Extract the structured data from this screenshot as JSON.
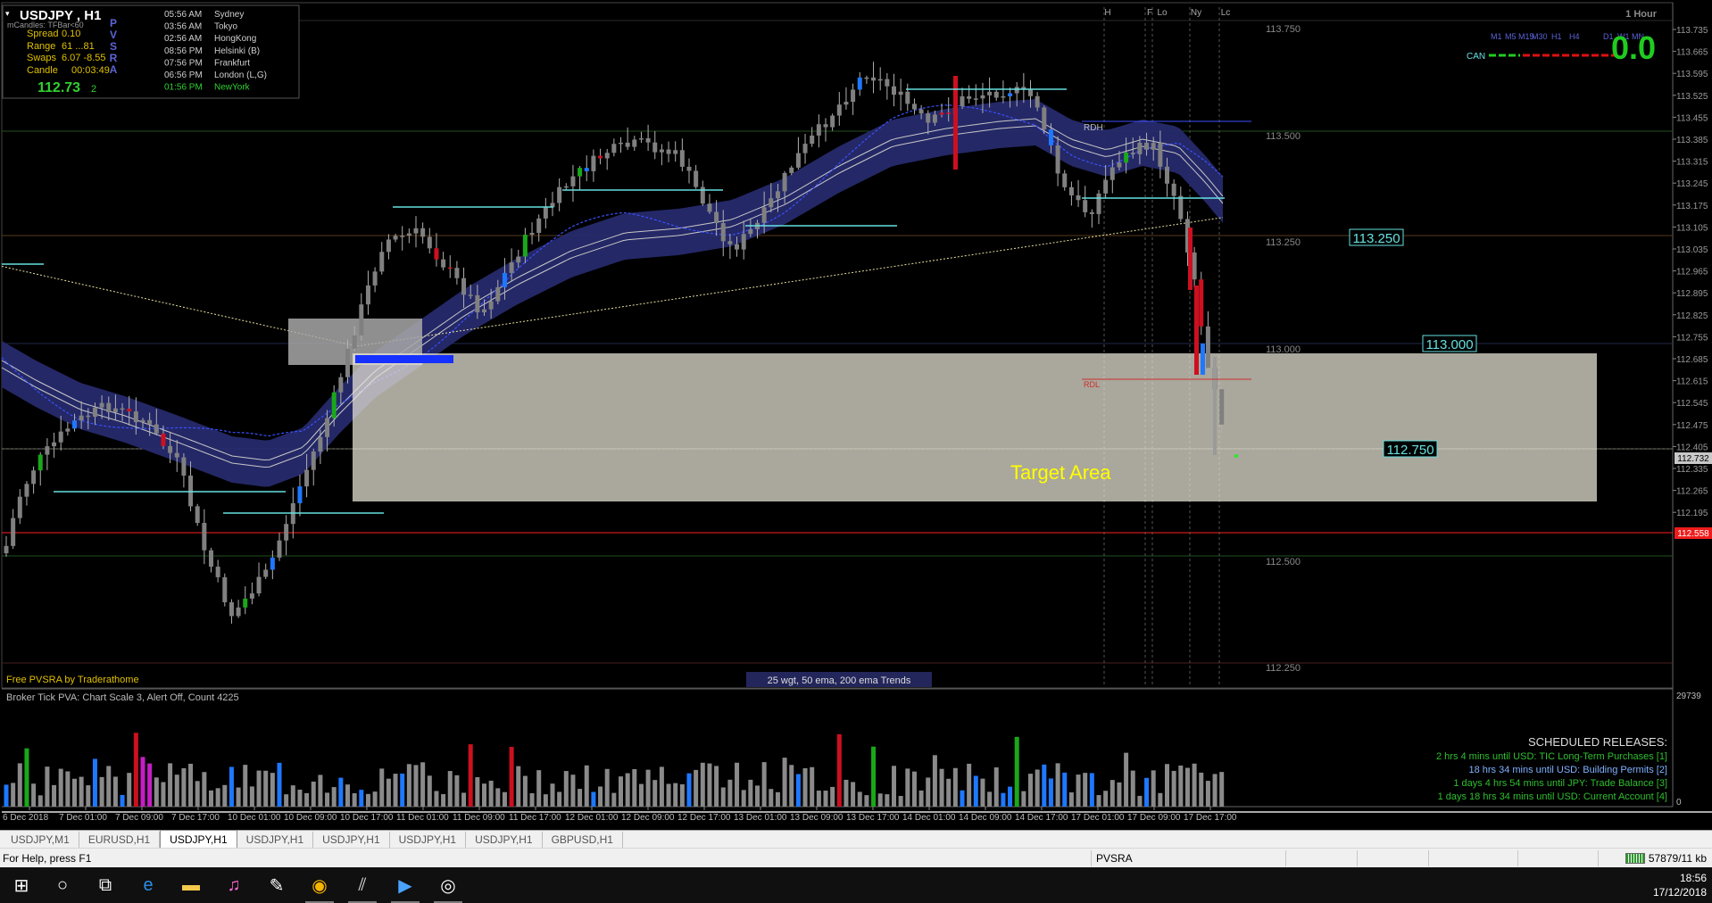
{
  "colors": {
    "background": "#000000",
    "bull_candle": "#1aa81a",
    "bear_candle": "#cc1020",
    "neutral_candle": "#808080",
    "climax_blue": "#1e78ff",
    "climax_magenta": "#c41ec4",
    "band": "#262a6b",
    "target_zone": "#ece7d8",
    "level_cyan": "#66e0e0",
    "label_yellow": "#ffff00"
  },
  "info_panel": {
    "symbol": "USDJPY , H1",
    "subtitle": "mCandles: TFBar<60",
    "spread_label": "Spread",
    "spread_value": "0.10",
    "range_label": "Range",
    "range_value": "61 ...81",
    "swaps_label": "Swaps",
    "swaps_value": "6.07 -8.55",
    "candle_label": "Candle",
    "candle_value": "00:03:49",
    "price_main": "112.73",
    "price_suffix": "2",
    "pvsra": [
      "P",
      "V",
      "S",
      "R",
      "A"
    ],
    "sessions": [
      {
        "time": "05:56 AM",
        "city": "Sydney"
      },
      {
        "time": "03:56 AM",
        "city": "Tokyo"
      },
      {
        "time": "02:56 AM",
        "city": "HongKong"
      },
      {
        "time": "08:56 PM",
        "city": "Helsinki (B)"
      },
      {
        "time": "07:56 PM",
        "city": "Frankfurt"
      },
      {
        "time": "06:56 PM",
        "city": "London (L,G)"
      },
      {
        "time": "01:56 PM",
        "city": "NewYork"
      }
    ]
  },
  "timeframes": [
    "M1",
    "M5",
    "M15",
    "M30",
    "H1",
    "H4",
    "D1",
    "W1",
    "MN"
  ],
  "can_label": "CAN",
  "big_value": "0.0",
  "top_corner_label": "1 Hour",
  "session_markers": [
    "H",
    "F",
    "Lo",
    "Ny",
    "Lc"
  ],
  "level_labels": {
    "rdh": "RDH",
    "rdl": "RDL"
  },
  "round_labels": [
    "113.750",
    "113.500",
    "113.250",
    "113.000",
    "112.500",
    "112.250"
  ],
  "boxed_levels": [
    "113.250",
    "113.000",
    "112.750"
  ],
  "target_label": "Target Area",
  "footer_credit": "Free PVSRA by Traderathome",
  "footer_trends": "25 wgt, 50 ema, 200 ema Trends",
  "price_axis": [
    "113.735",
    "113.665",
    "113.595",
    "113.525",
    "113.455",
    "113.385",
    "113.315",
    "113.245",
    "113.175",
    "113.105",
    "113.035",
    "112.965",
    "112.895",
    "112.825",
    "112.755",
    "112.685",
    "112.615",
    "112.545",
    "112.475",
    "112.405",
    "112.335",
    "112.265",
    "112.195"
  ],
  "current_price_tag": "112.732",
  "red_line_tag": "112.558",
  "volume_panel": {
    "header": "Broker Tick PVA:   Chart Scale  3,  Alert Off,  Count   4225",
    "axis_top": "29739",
    "axis_bottom": "0"
  },
  "scheduled": {
    "title": "SCHEDULED RELEASES:",
    "items": [
      {
        "text": "2 hrs 4 mins until USD: TIC Long-Term Purchases  [1]",
        "color": "#2fbf2f"
      },
      {
        "text": "18 hrs 34 mins until USD: Building Permits  [2]",
        "color": "#7fb0ff"
      },
      {
        "text": "1 days 4 hrs 54 mins until JPY: Trade Balance  [3]",
        "color": "#2fbf2f"
      },
      {
        "text": "1 days 18 hrs 34 mins until USD: Current Account  [4]",
        "color": "#2fbf2f"
      }
    ]
  },
  "time_axis": [
    "6 Dec 2018",
    "7 Dec 01:00",
    "7 Dec 09:00",
    "7 Dec 17:00",
    "10 Dec 01:00",
    "10 Dec 09:00",
    "10 Dec 17:00",
    "11 Dec 01:00",
    "11 Dec 09:00",
    "11 Dec 17:00",
    "12 Dec 01:00",
    "12 Dec 09:00",
    "12 Dec 17:00",
    "13 Dec 01:00",
    "13 Dec 09:00",
    "13 Dec 17:00",
    "14 Dec 01:00",
    "14 Dec 09:00",
    "14 Dec 17:00",
    "17 Dec 01:00",
    "17 Dec 09:00",
    "17 Dec 17:00"
  ],
  "tabs": [
    {
      "label": "USDJPY,M1",
      "active": false
    },
    {
      "label": "EURUSD,H1",
      "active": false
    },
    {
      "label": "USDJPY,H1",
      "active": true
    },
    {
      "label": "USDJPY,H1",
      "active": false
    },
    {
      "label": "USDJPY,H1",
      "active": false
    },
    {
      "label": "USDJPY,H1",
      "active": false
    },
    {
      "label": "USDJPY,H1",
      "active": false
    },
    {
      "label": "GBPUSD,H1",
      "active": false
    }
  ],
  "status": {
    "help": "For Help, press F1",
    "template": "PVSRA",
    "traffic": "57879/11 kb"
  },
  "taskbar": {
    "icons": [
      "windows-start-icon",
      "cortana-search-icon",
      "task-view-icon",
      "edge-browser-icon",
      "file-explorer-icon",
      "itunes-icon",
      "paint-icon",
      "chrome-icon",
      "metatrader-icon",
      "media-player-icon",
      "globe-app-icon"
    ],
    "time": "18:56",
    "date": "17/12/2018"
  }
}
